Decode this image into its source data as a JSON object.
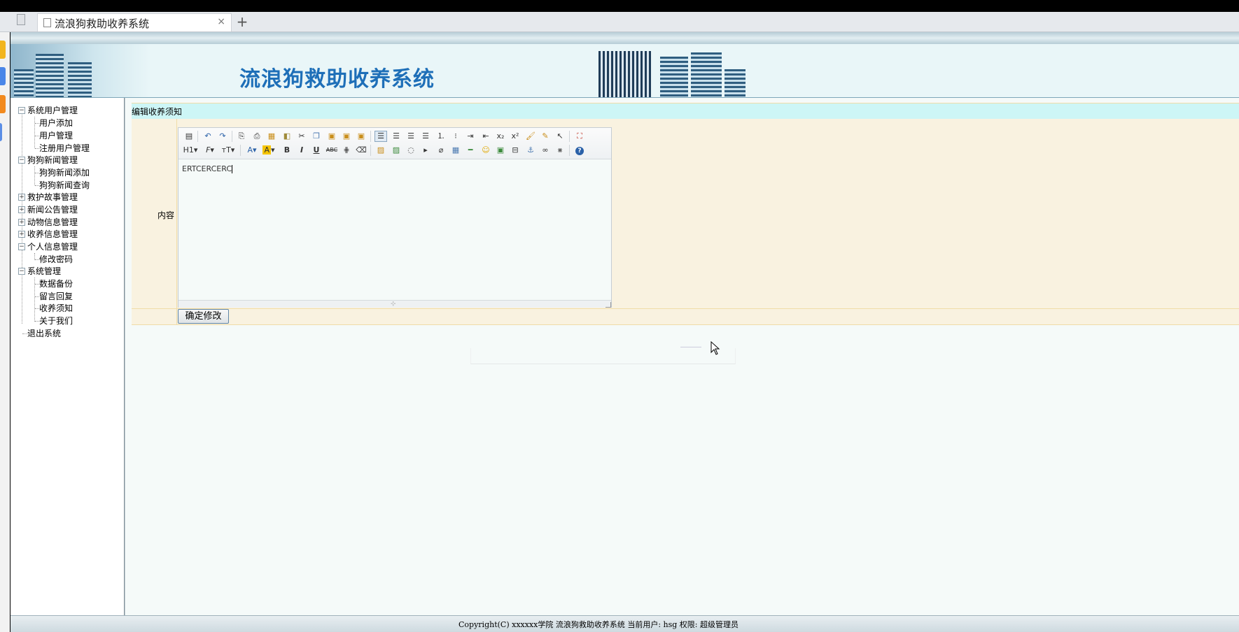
{
  "browser": {
    "tab_title": "流浪狗救助收养系统",
    "close_glyph": "×",
    "new_tab_glyph": "+"
  },
  "banner": {
    "title": "流浪狗救助收养系统"
  },
  "sidebar": {
    "items": [
      {
        "label": "系统用户管理",
        "level": 0,
        "expanded": true
      },
      {
        "label": "用户添加",
        "level": 1
      },
      {
        "label": "用户管理",
        "level": 1
      },
      {
        "label": "注册用户管理",
        "level": 1
      },
      {
        "label": "狗狗新闻管理",
        "level": 0,
        "expanded": true
      },
      {
        "label": "狗狗新闻添加",
        "level": 1
      },
      {
        "label": "狗狗新闻查询",
        "level": 1
      },
      {
        "label": "救护故事管理",
        "level": 0,
        "expanded": false
      },
      {
        "label": "新闻公告管理",
        "level": 0,
        "expanded": false
      },
      {
        "label": "动物信息管理",
        "level": 0,
        "expanded": false
      },
      {
        "label": "收养信息管理",
        "level": 0,
        "expanded": false
      },
      {
        "label": "个人信息管理",
        "level": 0,
        "expanded": true
      },
      {
        "label": "修改密码",
        "level": 1
      },
      {
        "label": "系统管理",
        "level": 0,
        "expanded": true
      },
      {
        "label": "数据备份",
        "level": 1
      },
      {
        "label": "留言回复",
        "level": 1
      },
      {
        "label": "收养须知",
        "level": 1
      },
      {
        "label": "关于我们",
        "level": 1
      },
      {
        "label": "退出系统",
        "level": 0,
        "leaf": true
      }
    ]
  },
  "form": {
    "header": "编辑收养须知",
    "content_label": "内容",
    "content_value": "ERTCERCERC",
    "submit_label": "确定修改"
  },
  "editor": {
    "toolbar_row1": [
      "source-icon",
      "undo-icon",
      "redo-icon",
      "preview-icon",
      "print-icon",
      "template-icon",
      "code-icon",
      "cut-icon",
      "copy-icon",
      "paste-icon",
      "paste-text-icon",
      "paste-word-icon",
      "align-left-icon",
      "align-center-icon",
      "align-right-icon",
      "justify-icon",
      "ordered-list-icon",
      "unordered-list-icon",
      "indent-icon",
      "outdent-icon",
      "subscript-icon",
      "superscript-icon",
      "clear-format-icon",
      "select-all-icon",
      "select-icon",
      "fullscreen-icon"
    ],
    "toolbar_row2": [
      "heading-icon",
      "font-family-icon",
      "font-size-icon",
      "font-color-icon",
      "highlight-icon",
      "bold-icon",
      "italic-icon",
      "underline-icon",
      "strikethrough-icon",
      "line-height-icon",
      "remove-format-icon",
      "image-icon",
      "multi-image-icon",
      "flash-icon",
      "media-icon",
      "attachment-icon",
      "table-icon",
      "hr-icon",
      "emoticon-icon",
      "map-icon",
      "pagebreak-icon",
      "anchor-icon",
      "link-icon",
      "unlink-icon",
      "help-icon"
    ],
    "heading_label": "H1",
    "font_family_label": "F",
    "font_size_label": "тT",
    "font_color_label": "A",
    "highlight_label": "A",
    "bold_label": "B",
    "italic_label": "I",
    "underline_label": "U",
    "strike_label": "ABC"
  },
  "footer": {
    "text": "Copyright(C) xxxxxx学院 流浪狗救助收养系统 当前用户: hsg 权限: 超级管理员"
  },
  "colors": {
    "banner_title": "#1e6fb8",
    "form_header_bg": "#cdf6f6",
    "row_bg": "#f9f2e0",
    "page_bg": "#f5faf9"
  }
}
